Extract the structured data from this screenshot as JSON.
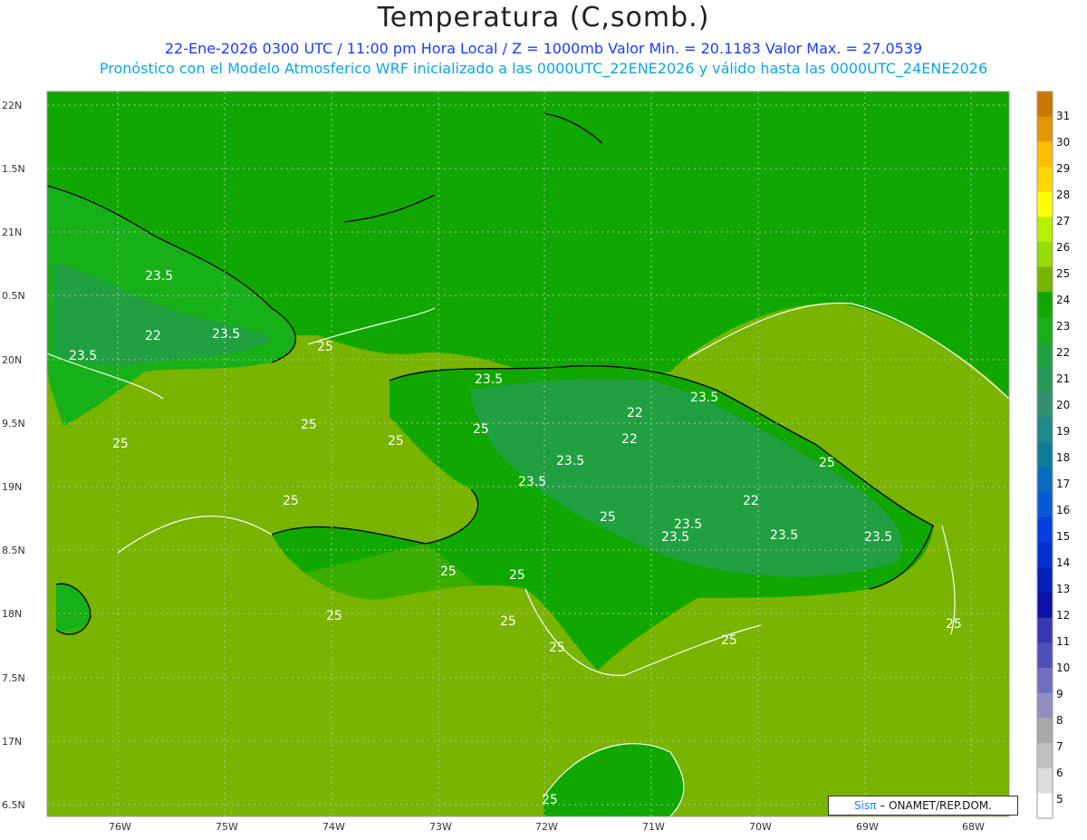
{
  "header": {
    "title": "Temperatura (C,somb.)",
    "line1": "22-Ene-2026 0300 UTC / 11:00 pm Hora Local / Z = 1000mb   Valor Min. = 20.1183  Valor Max. = 27.0539",
    "line2": "Pronóstico con el Modelo Atmosferico WRF inicializado a las 0000UTC_22ENE2026 y válido hasta las  0000UTC_24ENE2026"
  },
  "axes": {
    "lat_labels": [
      "22N",
      "1.5N",
      "21N",
      "0.5N",
      "20N",
      "9.5N",
      "19N",
      "8.5N",
      "18N",
      "7.5N",
      "17N",
      "6.5N"
    ],
    "lon_labels": [
      "76W",
      "75W",
      "74W",
      "73W",
      "72W",
      "71W",
      "70W",
      "69W",
      "68W"
    ]
  },
  "contour_labels": [
    "23.5",
    "22",
    "23.5",
    "23.5",
    "25",
    "25",
    "25",
    "23.5",
    "25",
    "22",
    "22",
    "23.5",
    "23.5",
    "25",
    "23.5",
    "22",
    "25",
    "23.5",
    "23.5",
    "23.5",
    "23.5",
    "25",
    "25",
    "25",
    "25",
    "25",
    "25",
    "25",
    "25",
    "25",
    "25"
  ],
  "colorbar": {
    "ticks": [
      "31",
      "30",
      "29",
      "28",
      "27",
      "26",
      "25",
      "24",
      "23",
      "22",
      "21",
      "20",
      "19",
      "18",
      "17",
      "16",
      "15",
      "14",
      "13",
      "12",
      "11",
      "10",
      "9",
      "8",
      "7",
      "6",
      "5"
    ],
    "colors": [
      "#c87800",
      "#e19600",
      "#ffbe00",
      "#ffd700",
      "#ffff00",
      "#b4f000",
      "#96dc00",
      "#78b400",
      "#10a800",
      "#18b018",
      "#20a040",
      "#289858",
      "#309070",
      "#208888",
      "#107c9c",
      "#086cbc",
      "#0858d8",
      "#0840e0",
      "#0030d0",
      "#0020b8",
      "#1010a8",
      "#3838b0",
      "#5050b8",
      "#7070c0",
      "#9090c0",
      "#a8a8a8",
      "#c0c0c0",
      "#dcdcdc",
      "#ffffff"
    ]
  },
  "credit": {
    "sis": "Sisπ",
    "rest": "– ONAMET/REP.DOM."
  }
}
